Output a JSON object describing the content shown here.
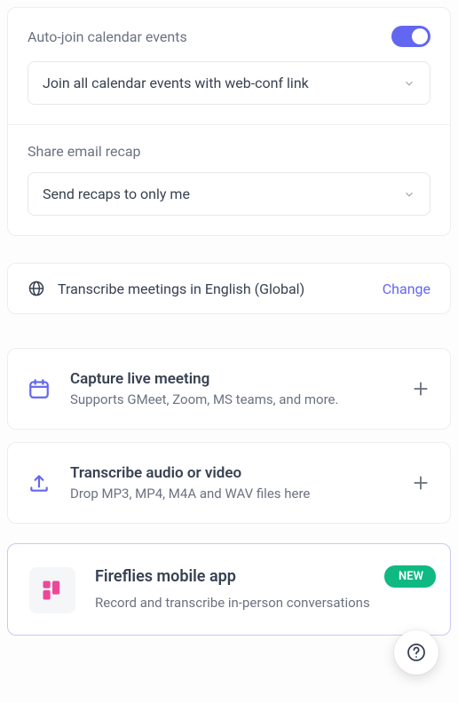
{
  "autojoin": {
    "label": "Auto-join calendar events",
    "select_value": "Join all calendar events with web-conf link",
    "toggle_on": true
  },
  "recap": {
    "label": "Share email recap",
    "select_value": "Send recaps to only me"
  },
  "transcribe": {
    "text": "Transcribe meetings in English (Global)",
    "change": "Change"
  },
  "capture": {
    "title": "Capture live meeting",
    "subtitle": "Supports GMeet, Zoom, MS teams, and more."
  },
  "upload": {
    "title": "Transcribe audio or video",
    "subtitle": "Drop MP3, MP4, M4A and WAV files here"
  },
  "mobile": {
    "title": "Fireflies mobile app",
    "subtitle": "Record and transcribe in-person conversations",
    "badge": "NEW"
  }
}
